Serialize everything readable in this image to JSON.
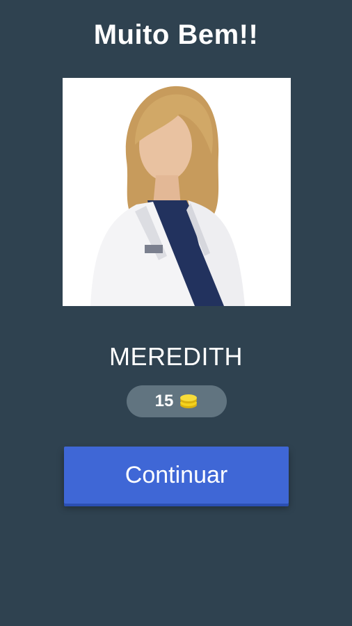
{
  "result": {
    "title": "Muito Bem!!",
    "answer": "MEREDITH"
  },
  "reward": {
    "coins": "15",
    "icon": "coin-stack-icon"
  },
  "actions": {
    "continue_label": "Continuar"
  },
  "colors": {
    "background": "#2f4250",
    "pill": "#617480",
    "button": "#3f67d6",
    "coin": "#f5d21c"
  }
}
